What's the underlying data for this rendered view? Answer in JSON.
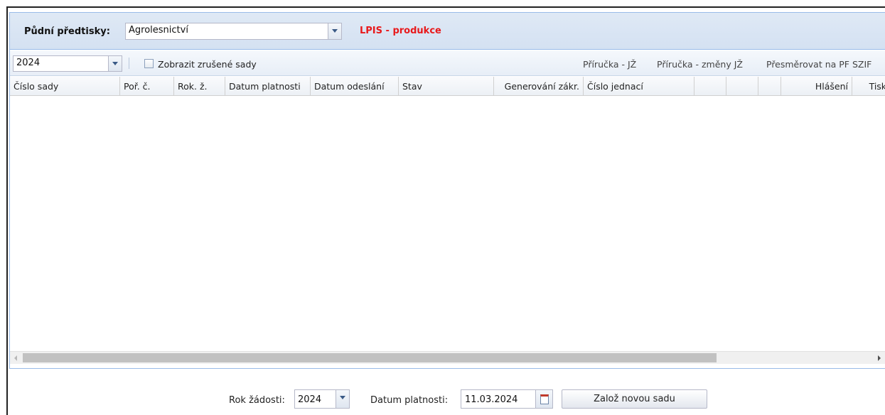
{
  "header": {
    "label": "Půdní předtisky:",
    "combo_value": "Agrolesnictví",
    "lpis_link": "LPIS - produkce"
  },
  "toolbar": {
    "year_value": "2024",
    "show_cancelled_label": "Zobrazit zrušené sady",
    "show_cancelled_checked": false,
    "links": [
      "Příručka - JŽ",
      "Příručka - změny JŽ",
      "Přesměrovat na PF SZIF"
    ]
  },
  "grid": {
    "columns": [
      "Číslo sady",
      "Poř. č.",
      "Rok. ž.",
      "Datum platnosti",
      "Datum odeslání",
      "Stav",
      "Generování zákr.",
      "Číslo jednací",
      "",
      "",
      "",
      "Hlášení",
      "Tisky"
    ],
    "rows": []
  },
  "footer": {
    "year_label": "Rok žádosti:",
    "year_value": "2024",
    "date_label": "Datum platnosti:",
    "date_value": "11.03.2024",
    "create_button": "Založ novou sadu"
  },
  "colors": {
    "accent_red": "#e8191b",
    "header_bg": "#d4e1f2",
    "border_blue": "#99bbe8"
  }
}
